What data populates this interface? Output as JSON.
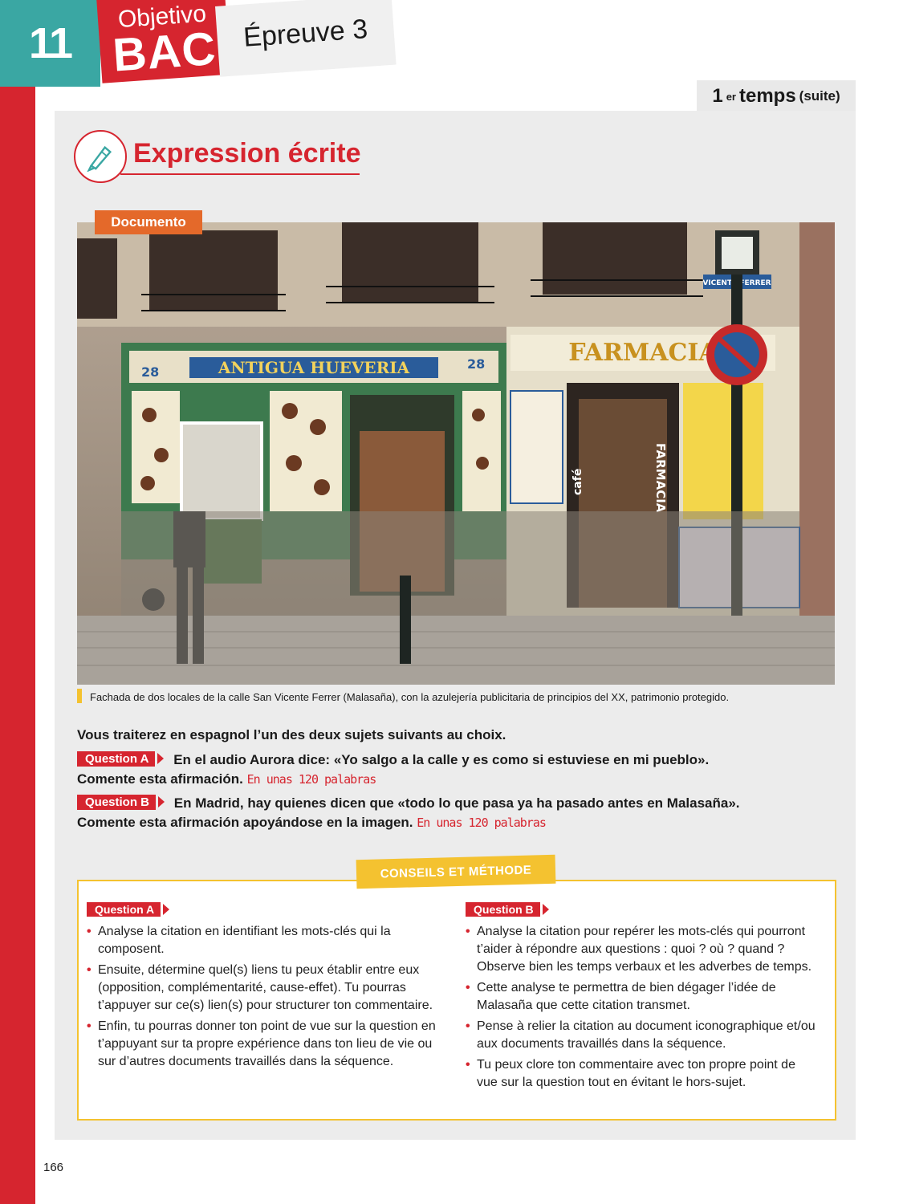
{
  "header": {
    "chapter": "11",
    "objetivo": "Objetivo",
    "bac": "BAC",
    "epreuve": "Épreuve 3",
    "temps_num": "1",
    "temps_sup": "er",
    "temps_word": "temps",
    "temps_suite": "(suite)"
  },
  "section": {
    "title": "Expression écrite"
  },
  "document": {
    "label": "Documento",
    "caption": "Fachada de dos locales de la calle San Vicente Ferrer (Malasaña), con la azulejería publicitaria de principios del XX, patrimonio protegido.",
    "signs": {
      "hueveria": "ANTIGUA HUEVERIA",
      "num_left": "28",
      "num_right": "28",
      "farmacia": "FARMACIA",
      "cafe": "café",
      "vertical_farmacia": "FARMACIA",
      "street": "VICENTE FERRER"
    }
  },
  "instructions": {
    "intro": "Vous traiterez en espagnol l’un des deux sujets suivants au choix.",
    "questions": [
      {
        "tag": "Question A",
        "line1": "En el audio Aurora dice: «Yo salgo a la calle y es como si estuviese en mi pueblo».",
        "line2": "Comente esta afirmación.",
        "limit": "En unas 120 palabras"
      },
      {
        "tag": "Question B",
        "line1": "En Madrid, hay quienes dicen que «todo lo que pasa ya ha pasado antes en Malasaña».",
        "line2": "Comente esta afirmación apoyándose en la imagen.",
        "limit": "En unas 120 palabras"
      }
    ]
  },
  "conseils": {
    "title": "CONSEILS ET MÉTHODE",
    "question_a": {
      "tag": "Question A",
      "bullets": [
        "Analyse la citation en identifiant les mots-clés qui la composent.",
        "Ensuite, détermine quel(s) liens tu peux établir entre eux (opposition, complémentarité, cause-effet). Tu pourras t’appuyer sur ce(s) lien(s) pour structurer ton commentaire.",
        "Enfin, tu pourras donner ton point de vue sur la question en t’appuyant sur ta propre expérience dans ton lieu de vie ou sur d’autres documents travaillés dans la séquence."
      ]
    },
    "question_b": {
      "tag": "Question B",
      "bullets": [
        "Analyse la citation pour repérer les mots-clés qui pourront t’aider à répondre aux questions : quoi ? où ? quand ? Observe bien les temps verbaux et les adverbes de temps.",
        "Cette analyse te permettra de bien dégager l’idée de Malasaña que cette citation transmet.",
        "Pense à relier la citation au document iconographique et/ou aux documents travaillés dans la séquence.",
        "Tu peux clore ton commentaire avec ton propre point de vue sur la question tout en évitant le hors-sujet."
      ]
    }
  },
  "page_number": "166"
}
